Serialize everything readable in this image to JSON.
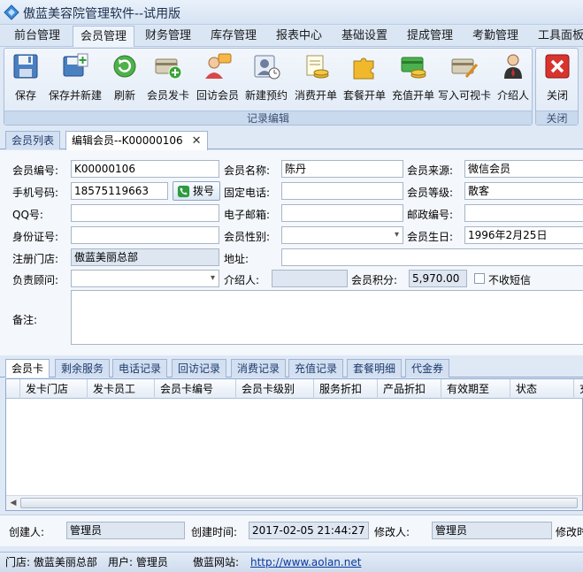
{
  "app": {
    "title": "傲蓝美容院管理软件--试用版"
  },
  "menu": [
    "前台管理",
    "会员管理",
    "财务管理",
    "库存管理",
    "报表中心",
    "基础设置",
    "提成管理",
    "考勤管理",
    "工具面板"
  ],
  "ribbon": {
    "buttons": [
      {
        "label": "保存",
        "icon": "floppy-disk-icon"
      },
      {
        "label": "保存并新建",
        "icon": "save-new-icon"
      },
      {
        "label": "刷新",
        "icon": "refresh-icon"
      },
      {
        "label": "会员发卡",
        "icon": "card-add-icon"
      },
      {
        "label": "回访会员",
        "icon": "chat-person-icon"
      },
      {
        "label": "新建预约",
        "icon": "id-card-clock-icon"
      },
      {
        "label": "消费开单",
        "icon": "receipt-coins-icon"
      },
      {
        "label": "套餐开单",
        "icon": "puzzle-icon"
      },
      {
        "label": "充值开单",
        "icon": "card-coins-icon"
      },
      {
        "label": "写入可视卡",
        "icon": "card-write-icon"
      },
      {
        "label": "介绍人",
        "icon": "person-suit-icon"
      }
    ],
    "group_label": "记录编辑",
    "close": {
      "label": "关闭",
      "icon": "close-icon",
      "group_label": "关闭"
    }
  },
  "doc_tabs": {
    "list": "会员列表",
    "edit": "编辑会员--K00000106"
  },
  "form": {
    "member_no_label": "会员编号:",
    "member_no": "K00000106",
    "name_label": "会员名称:",
    "name": "陈丹",
    "source_label": "会员来源:",
    "source": "微信会员",
    "mobile_label": "手机号码:",
    "mobile": "18575119663",
    "dial_label": "拨号",
    "phone_label": "固定电话:",
    "phone": "",
    "level_label": "会员等级:",
    "level": "散客",
    "qq_label": "QQ号:",
    "qq": "",
    "email_label": "电子邮箱:",
    "email": "",
    "zip_label": "邮政编号:",
    "zip": "",
    "idcard_label": "身份证号:",
    "idcard": "",
    "gender_label": "会员性别:",
    "gender": "",
    "birthday_label": "会员生日:",
    "birthday": "1996年2月25日",
    "store_label": "注册门店:",
    "store": "傲蓝美丽总部",
    "address_label": "地址:",
    "address": "",
    "advisor_label": "负责顾问:",
    "advisor": "",
    "referrer_label": "介绍人:",
    "referrer": "",
    "points_label": "会员积分:",
    "points": "5,970.00",
    "nosms_label": "不收短信",
    "note_label": "备注:",
    "note": ""
  },
  "sub_tabs": [
    "会员卡",
    "剩余服务",
    "电话记录",
    "回访记录",
    "消费记录",
    "充值记录",
    "套餐明细",
    "代金券"
  ],
  "grid": {
    "columns": [
      "发卡门店",
      "发卡员工",
      "会员卡编号",
      "会员卡级别",
      "服务折扣",
      "产品折扣",
      "有效期至",
      "状态",
      "充值"
    ]
  },
  "info": {
    "creator_label": "创建人:",
    "creator": "管理员",
    "created_label": "创建时间:",
    "created": "2017-02-05 21:44:27",
    "modifier_label": "修改人:",
    "modifier": "管理员",
    "modified_label": "修改时"
  },
  "status": {
    "store": "门店: 傲蓝美丽总部",
    "user": "用户: 管理员",
    "site_label": "傲蓝网站:",
    "site_url": "http://www.aolan.net"
  }
}
